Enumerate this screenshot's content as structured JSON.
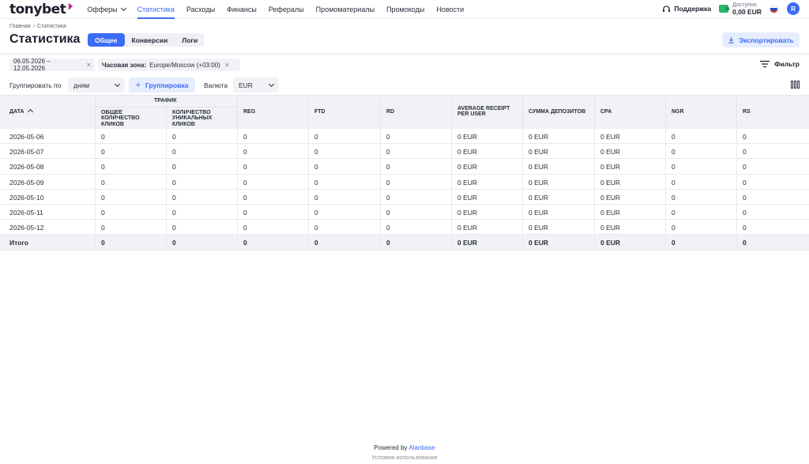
{
  "brand": {
    "name": "tonybet"
  },
  "nav": {
    "items": [
      {
        "label": "Офферы",
        "dropdown": true,
        "active": false
      },
      {
        "label": "Статистика",
        "active": true
      },
      {
        "label": "Расходы",
        "active": false
      },
      {
        "label": "Финансы",
        "active": false
      },
      {
        "label": "Рефералы",
        "active": false
      },
      {
        "label": "Промоматериалы",
        "active": false
      },
      {
        "label": "Промокоды",
        "active": false
      },
      {
        "label": "Новости",
        "active": false
      }
    ],
    "support_label": "Поддержка",
    "balance_label": "Доступно",
    "balance_value": "0,00 EUR",
    "avatar_letter": "R"
  },
  "breadcrumb": {
    "home": "Главная",
    "current": "Статистика"
  },
  "page": {
    "title": "Статистика",
    "tabs": [
      "Общее",
      "Конверсии",
      "Логи"
    ],
    "active_tab": 0,
    "export_label": "Экспортировать"
  },
  "filters": {
    "date_range": "06.05.2026 – 12.05.2026",
    "timezone_label": "Часовая зона:",
    "timezone_value": "Europe/Moscow (+03:00)",
    "filter_label": "Фильтр"
  },
  "controls": {
    "group_by_label": "Группировать по",
    "group_by_value": "дням",
    "add_group_label": "Группировка",
    "currency_label": "Валюта",
    "currency_value": "EUR"
  },
  "table": {
    "col_date": "ДАТА",
    "group_traffic": "ТРАФИК",
    "col_clicks": "ОБЩЕЕ КОЛИЧЕСТВО КЛИКОВ",
    "col_unique": "КОЛИЧЕСТВО УНИКАЛЬНЫХ КЛИКОВ",
    "col_reg": "REG",
    "col_ftd": "FTD",
    "col_rd": "RD",
    "col_arpu": "AVERAGE RECEIPT PER USER",
    "col_deposits": "СУММА ДЕПОЗИТОВ",
    "col_cpa": "CPA",
    "col_ngr": "NGR",
    "col_rs": "RS",
    "rows": [
      [
        "2026-05-06",
        "0",
        "0",
        "0",
        "0",
        "0",
        "0 EUR",
        "0 EUR",
        "0 EUR",
        "0",
        "0"
      ],
      [
        "2026-05-07",
        "0",
        "0",
        "0",
        "0",
        "0",
        "0 EUR",
        "0 EUR",
        "0 EUR",
        "0",
        "0"
      ],
      [
        "2026-05-08",
        "0",
        "0",
        "0",
        "0",
        "0",
        "0 EUR",
        "0 EUR",
        "0 EUR",
        "0",
        "0"
      ],
      [
        "2026-05-09",
        "0",
        "0",
        "0",
        "0",
        "0",
        "0 EUR",
        "0 EUR",
        "0 EUR",
        "0",
        "0"
      ],
      [
        "2026-05-10",
        "0",
        "0",
        "0",
        "0",
        "0",
        "0 EUR",
        "0 EUR",
        "0 EUR",
        "0",
        "0"
      ],
      [
        "2026-05-11",
        "0",
        "0",
        "0",
        "0",
        "0",
        "0 EUR",
        "0 EUR",
        "0 EUR",
        "0",
        "0"
      ],
      [
        "2026-05-12",
        "0",
        "0",
        "0",
        "0",
        "0",
        "0 EUR",
        "0 EUR",
        "0 EUR",
        "0",
        "0"
      ]
    ],
    "total": [
      "Итого",
      "0",
      "0",
      "0",
      "0",
      "0",
      "0 EUR",
      "0 EUR",
      "0 EUR",
      "0",
      "0"
    ]
  },
  "footer": {
    "powered_by": "Powered by",
    "vendor": "Alanbase",
    "terms": "Условия использования"
  },
  "colors": {
    "accent": "#3b6cf6",
    "logo_red": "#e8262e",
    "logo_purple": "#7b2ff7",
    "wallet_green": "#2db36a"
  }
}
